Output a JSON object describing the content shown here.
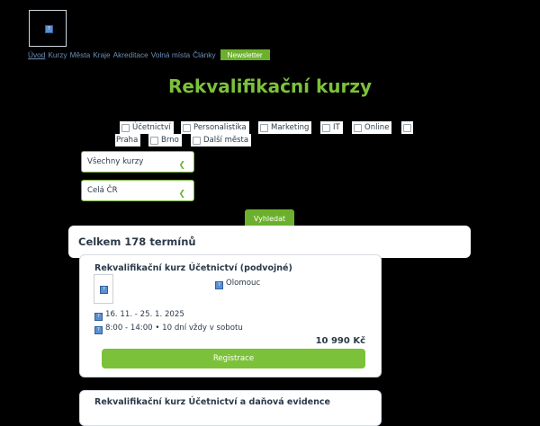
{
  "nav": {
    "items": [
      "Úvod",
      "Kurzy",
      "Města",
      "Kraje",
      "Akreditace",
      "Volná místa",
      "Články"
    ],
    "newsletter": "Newsletter"
  },
  "title": "Rekvalifikační kurzy",
  "filters": [
    "Účetnictví",
    "Personalistika",
    "Marketing",
    "IT",
    "Online",
    "",
    "Praha",
    "Brno",
    "Další města"
  ],
  "selects": {
    "course": "Všechny kurzy",
    "region": "Celá ČR"
  },
  "search_label": "Vyhledat",
  "total": "Celkem 178 termínů",
  "courses": [
    {
      "title": "Rekvalifikační kurz Účetnictví (podvojné)",
      "location": "Olomouc",
      "dates": "16. 11. - 25. 1. 2025",
      "schedule": "8:00 - 14:00 • 10 dní vždy v sobotu",
      "price": "10 990 Kč",
      "register": "Registrace"
    },
    {
      "title": "Rekvalifikační kurz Účetnictví a daňová evidence"
    }
  ],
  "icons": [
    "logo-placeholder-icon",
    "thumbnail-icon",
    "location-icon",
    "calendar-icon",
    "clock-icon"
  ],
  "colors": {
    "accent": "#7cc13a",
    "background": "#000000",
    "text": "#2b3a4a",
    "link": "#6b8fb8"
  }
}
